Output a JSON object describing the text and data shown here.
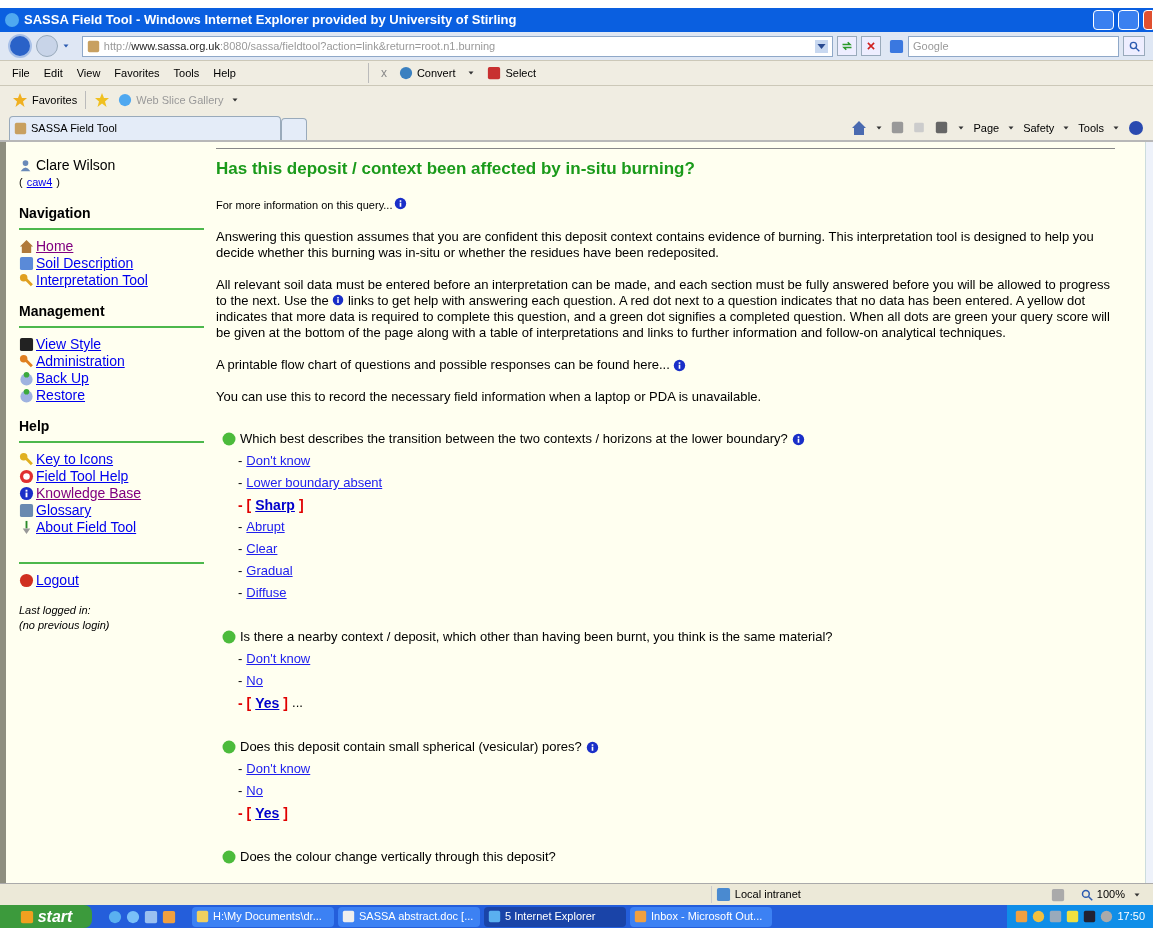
{
  "window": {
    "title": "SASSA Field Tool - Windows Internet Explorer provided by University of Stirling"
  },
  "address_bar": {
    "url_prefix": "http://",
    "url_host": "www.sassa.org.uk",
    "url_path": ":8080/sassa/fieldtool?action=link&return=root.n1.burning",
    "search_placeholder": "Google"
  },
  "menu_bar": [
    "File",
    "Edit",
    "View",
    "Favorites",
    "Tools",
    "Help"
  ],
  "toolbar": {
    "close_mark": "x",
    "convert": "Convert",
    "select": "Select"
  },
  "favorites_bar": {
    "favorites": "Favorites",
    "web_slice": "Web Slice Gallery"
  },
  "tabs": [
    {
      "label": "SASSA Field Tool",
      "selected": true
    }
  ],
  "command_bar": [
    "Page",
    "Safety",
    "Tools"
  ],
  "sidebar": {
    "user": "Clare Wilson",
    "username_open": "(",
    "username": "caw4",
    "username_close": ")",
    "sections": [
      {
        "title": "Navigation",
        "items": [
          {
            "label": "Home",
            "visited": true
          },
          {
            "label": "Soil Description",
            "visited": false
          },
          {
            "label": "Interpretation Tool",
            "visited": false
          }
        ]
      },
      {
        "title": "Management",
        "items": [
          {
            "label": "View Style",
            "visited": false
          },
          {
            "label": "Administration",
            "visited": false
          },
          {
            "label": "Back Up",
            "visited": false
          },
          {
            "label": "Restore",
            "visited": false
          }
        ]
      },
      {
        "title": "Help",
        "items": [
          {
            "label": "Key to Icons",
            "visited": false
          },
          {
            "label": "Field Tool Help",
            "visited": false
          },
          {
            "label": "Knowledge Base",
            "visited": true
          },
          {
            "label": "Glossary",
            "visited": false
          },
          {
            "label": "About Field Tool",
            "visited": false
          }
        ]
      }
    ],
    "logout": "Logout",
    "last_login_label": "Last logged in:",
    "last_login_value": "(no previous login)"
  },
  "content": {
    "heading": "Has this deposit / context been affected by in-situ burning?",
    "more_info": "For more information on this query...",
    "intro": "Answering this question assumes that you are confident this deposit context contains evidence of burning. This interpretation tool is designed to help you decide whether this burning was in-situ or whether the residues have been redeposited.",
    "instructions_before": "All relevant soil data must be entered before an interpretation can be made, and each section must be fully answered before you will be allowed to progress to the next. Use the",
    "instructions_after": "links to get help with answering each question. A red dot next to a question indicates that no data has been entered. A yellow dot indicates that more data is required to complete this question, and a green dot signifies a completed question. When all dots are green your query score will be given at the bottom of the page along with a table of interpretations and links to further information and follow-on analytical techniques.",
    "flow_chart": "A printable flow chart of questions and possible responses can be found here...",
    "record_note": "You can use this to record the necessary field information when a laptop or PDA is unavailable.",
    "questions": [
      {
        "text": "Which best describes the transition between the two contexts / horizons at the lower boundary?",
        "color": "#4cbb3c",
        "info": true,
        "options": [
          {
            "prefix": "-",
            "label": "Don't know",
            "selected": false
          },
          {
            "prefix": "-",
            "label": "Lower boundary absent",
            "selected": false
          },
          {
            "prefix": "- [",
            "label": "Sharp",
            "closing": "]",
            "selected": true
          },
          {
            "prefix": "-",
            "label": "Abrupt",
            "selected": false
          },
          {
            "prefix": "-",
            "label": "Clear",
            "selected": false
          },
          {
            "prefix": "-",
            "label": "Gradual",
            "selected": false
          },
          {
            "prefix": "-",
            "label": "Diffuse",
            "selected": false
          }
        ]
      },
      {
        "text": "Is there a nearby context / deposit, which other than having been burnt, you think is the same material?",
        "color": "#4cbb3c",
        "info": false,
        "options": [
          {
            "prefix": "-",
            "label": "Don't know",
            "selected": false
          },
          {
            "prefix": "-",
            "label": "No",
            "selected": false
          },
          {
            "prefix": "- [",
            "label": "Yes",
            "closing": "]",
            "trailing": "...",
            "selected": true
          }
        ]
      },
      {
        "text": "Does this deposit contain small spherical (vesicular) pores?",
        "color": "#4cbb3c",
        "info": true,
        "options": [
          {
            "prefix": "-",
            "label": "Don't know",
            "selected": false
          },
          {
            "prefix": "-",
            "label": "No",
            "selected": false
          },
          {
            "prefix": "- [",
            "label": "Yes",
            "closing": "]",
            "selected": true
          }
        ]
      },
      {
        "text": "Does the colour change vertically through this deposit?",
        "color": "#4cbb3c",
        "info": false
      }
    ]
  },
  "status_bar": {
    "zone": "Local intranet",
    "zoom": "100%"
  },
  "taskbar": {
    "start": "start",
    "tasks": [
      {
        "label": "H:\\My Documents\\dr...",
        "selected": false
      },
      {
        "label": "SASSA abstract.doc [...",
        "selected": false
      },
      {
        "label": "5 Internet Explorer",
        "selected": true
      },
      {
        "label": "Inbox - Microsoft Out...",
        "selected": false
      }
    ],
    "clock": "17:50"
  }
}
